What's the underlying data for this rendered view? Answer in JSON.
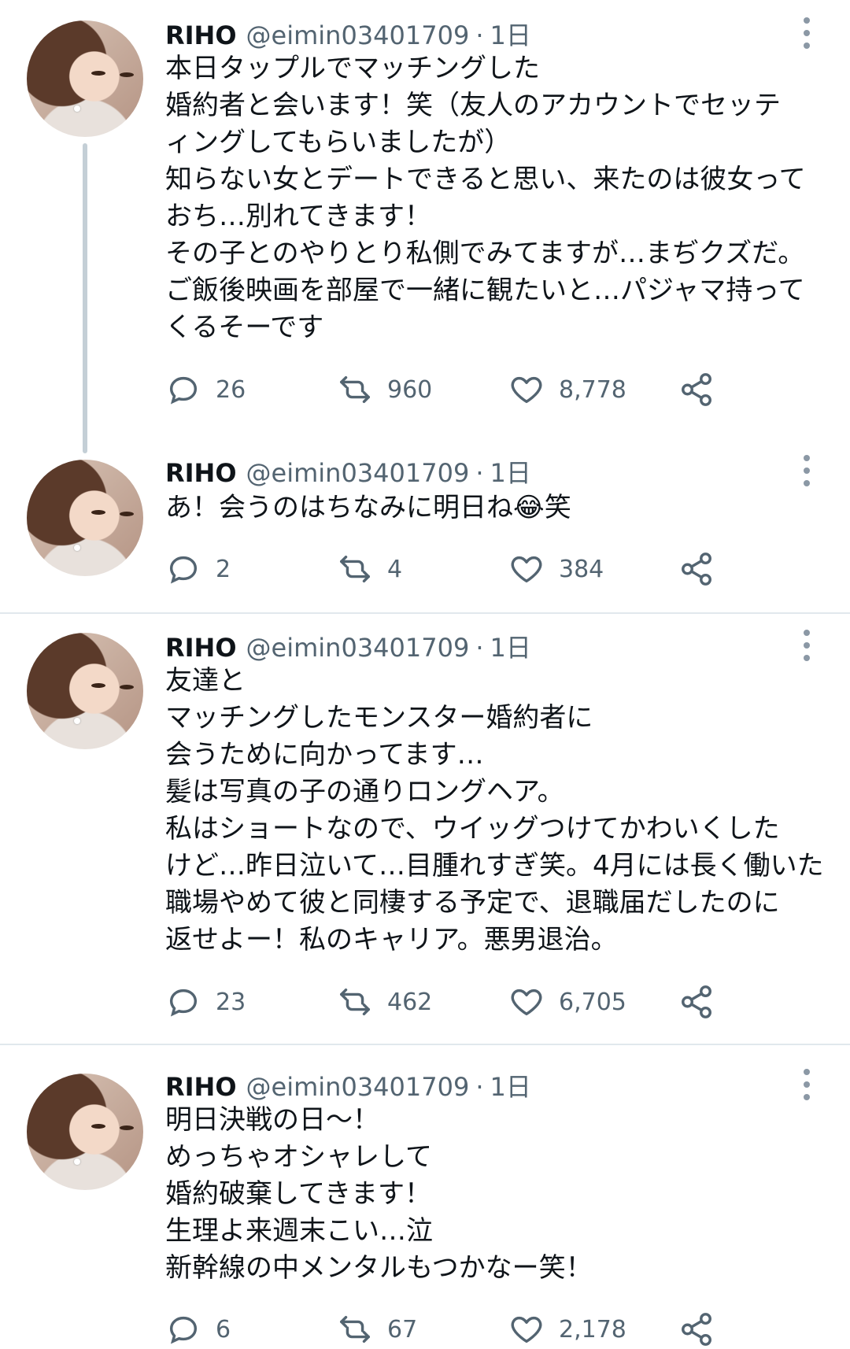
{
  "tweets": [
    {
      "name": "RIHO",
      "handle": "@eimin03401709",
      "separator": "·",
      "time": "1日",
      "text": "本日タップルでマッチングした\n婚約者と会います！笑（友人のアカウントでセッテ\nィングしてもらいましたが）\n知らない女とデートできると思い、来たのは彼女って\nおち…別れてきます！\nその子とのやりとり私側でみてますが…まぢクズだ。\nご飯後映画を部屋で一緒に観たいと…パジャマ持って\nくるそーです",
      "replies": "26",
      "retweets": "960",
      "likes": "8,778"
    },
    {
      "name": "RIHO",
      "handle": "@eimin03401709",
      "separator": "·",
      "time": "1日",
      "text": "あ！会うのはちなみに明日ね😂笑",
      "replies": "2",
      "retweets": "4",
      "likes": "384"
    },
    {
      "name": "RIHO",
      "handle": "@eimin03401709",
      "separator": "·",
      "time": "1日",
      "text": "友達と\nマッチングしたモンスター婚約者に\n会うために向かってます…\n髪は写真の子の通りロングヘア。\n私はショートなので、ウイッグつけてかわいくした\nけど…昨日泣いて…目腫れすぎ笑。4月には長く働いた\n職場やめて彼と同棲する予定で、退職届だしたのに\n返せよー！私のキャリア。悪男退治。",
      "replies": "23",
      "retweets": "462",
      "likes": "6,705"
    },
    {
      "name": "RIHO",
      "handle": "@eimin03401709",
      "separator": "·",
      "time": "1日",
      "text": "明日決戦の日〜！\nめっちゃオシャレして\n婚約破棄してきます！\n生理よ来週末こい…泣\n新幹線の中メンタルもつかなー笑！",
      "replies": "6",
      "retweets": "67",
      "likes": "2,178"
    }
  ],
  "icons": {
    "reply": "reply-icon",
    "retweet": "retweet-icon",
    "like": "heart-icon",
    "share": "share-icon",
    "more": "more-vertical-icon"
  },
  "colors": {
    "text": "#0f1419",
    "secondary": "#536471",
    "thread_line": "#c4cfd6",
    "divider": "#e1e8ed"
  }
}
